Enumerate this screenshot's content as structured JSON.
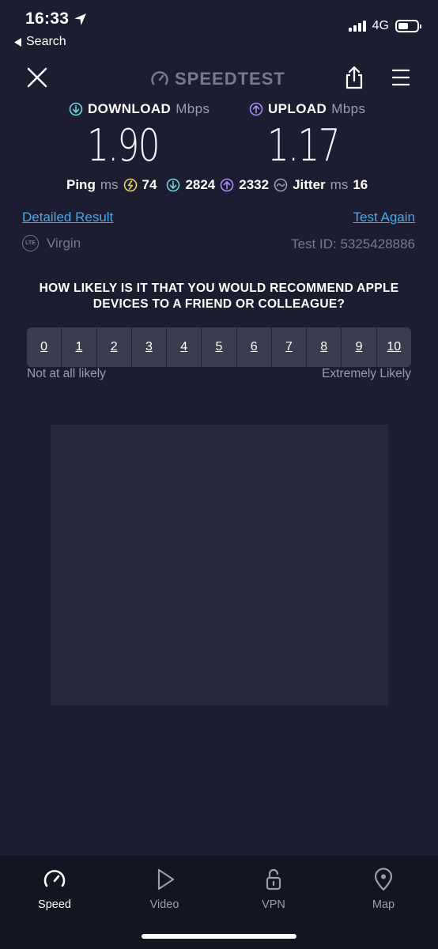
{
  "status_bar": {
    "time": "16:33",
    "back_label": "Search",
    "network": "4G"
  },
  "header": {
    "logo_text": "SPEEDTEST"
  },
  "results": {
    "download": {
      "label": "DOWNLOAD",
      "unit": "Mbps",
      "value": "1.90"
    },
    "upload": {
      "label": "UPLOAD",
      "unit": "Mbps",
      "value": "1.17"
    },
    "ping": {
      "label": "Ping",
      "unit": "ms",
      "idle": "74",
      "download": "2824",
      "upload": "2332"
    },
    "jitter": {
      "label": "Jitter",
      "unit": "ms",
      "value": "16"
    }
  },
  "links": {
    "detailed": "Detailed Result",
    "test_again": "Test Again"
  },
  "provider": {
    "badge": "LTE",
    "name": "Virgin",
    "test_id": "Test ID: 5325428886"
  },
  "survey": {
    "question": "HOW LIKELY IS IT THAT YOU WOULD RECOMMEND APPLE DEVICES TO A FRIEND OR COLLEAGUE?",
    "options": [
      "0",
      "1",
      "2",
      "3",
      "4",
      "5",
      "6",
      "7",
      "8",
      "9",
      "10"
    ],
    "low_label": "Not at all likely",
    "high_label": "Extremely Likely"
  },
  "tabs": [
    {
      "label": "Speed",
      "icon": "speedometer-icon",
      "active": true
    },
    {
      "label": "Video",
      "icon": "play-icon",
      "active": false
    },
    {
      "label": "VPN",
      "icon": "lock-icon",
      "active": false
    },
    {
      "label": "Map",
      "icon": "map-pin-icon",
      "active": false
    }
  ],
  "colors": {
    "background": "#1c1d30",
    "download_accent": "#6fd3e0",
    "upload_accent": "#a98bf5",
    "ping_accent": "#e8d26a",
    "link": "#4aa8e8"
  }
}
